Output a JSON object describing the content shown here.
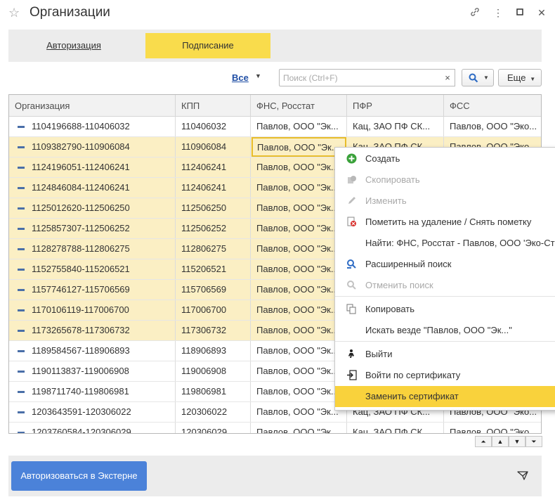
{
  "window": {
    "title": "Организации"
  },
  "tabs": [
    {
      "label": "Авторизация"
    },
    {
      "label": "Подписание"
    }
  ],
  "toolbar": {
    "filter_label": "Все",
    "search_placeholder": "Поиск (Ctrl+F)",
    "more_label": "Еще"
  },
  "table": {
    "columns": [
      "Организация",
      "КПП",
      "ФНС, Росстат",
      "ПФР",
      "ФСС"
    ],
    "rows": [
      {
        "org": "1104196688-110406032",
        "kpp": "110406032",
        "fns": "Павлов, ООО \"Эк...",
        "pfr": "Кац, ЗАО ПФ СК...",
        "fss": "Павлов, ООО \"Эко...",
        "selected": false
      },
      {
        "org": "1109382790-110906084",
        "kpp": "110906084",
        "fns": "Павлов, ООО \"Эк...",
        "pfr": "Кац, ЗАО ПФ СК...",
        "fss": "Павлов, ООО \"Эко...",
        "selected": true
      },
      {
        "org": "1124196051-112406241",
        "kpp": "112406241",
        "fns": "Павлов, ООО \"Эк...",
        "pfr": "",
        "fss": "",
        "selected": true
      },
      {
        "org": "1124846084-112406241",
        "kpp": "112406241",
        "fns": "Павлов, ООО \"Эк...",
        "pfr": "",
        "fss": "",
        "selected": true
      },
      {
        "org": "1125012620-112506250",
        "kpp": "112506250",
        "fns": "Павлов, ООО \"Эк...",
        "pfr": "",
        "fss": "",
        "selected": true
      },
      {
        "org": "1125857307-112506252",
        "kpp": "112506252",
        "fns": "Павлов, ООО \"Эк...",
        "pfr": "",
        "fss": "",
        "selected": true
      },
      {
        "org": "1128278788-112806275",
        "kpp": "112806275",
        "fns": "Павлов, ООО \"Эк...",
        "pfr": "",
        "fss": "",
        "selected": true
      },
      {
        "org": "1152755840-115206521",
        "kpp": "115206521",
        "fns": "Павлов, ООО \"Эк...",
        "pfr": "",
        "fss": "",
        "selected": true
      },
      {
        "org": "1157746127-115706569",
        "kpp": "115706569",
        "fns": "Павлов, ООО \"Эк...",
        "pfr": "",
        "fss": "",
        "selected": true
      },
      {
        "org": "1170106119-117006700",
        "kpp": "117006700",
        "fns": "Павлов, ООО \"Эк...",
        "pfr": "",
        "fss": "",
        "selected": true
      },
      {
        "org": "1173265678-117306732",
        "kpp": "117306732",
        "fns": "Павлов, ООО \"Эк...",
        "pfr": "",
        "fss": "",
        "selected": true
      },
      {
        "org": "1189584567-118906893",
        "kpp": "118906893",
        "fns": "Павлов, ООО \"Эк...",
        "pfr": "",
        "fss": "",
        "selected": false
      },
      {
        "org": "1190113837-119006908",
        "kpp": "119006908",
        "fns": "Павлов, ООО \"Эк...",
        "pfr": "",
        "fss": "",
        "selected": false
      },
      {
        "org": "1198711740-119806981",
        "kpp": "119806981",
        "fns": "Павлов, ООО \"Эк...",
        "pfr": "",
        "fss": "",
        "selected": false
      },
      {
        "org": "1203643591-120306022",
        "kpp": "120306022",
        "fns": "Павлов, ООО \"Эк...",
        "pfr": "Кац, ЗАО ПФ СК...",
        "fss": "Павлов, ООО \"Эко...",
        "selected": false
      },
      {
        "org": "1203760584-120306029",
        "kpp": "120306029",
        "fns": "Павлов, ООО \"Эк...",
        "pfr": "Кац, ЗАО ПФ СК...",
        "fss": "Павлов, ООО \"Эко...",
        "selected": false
      }
    ]
  },
  "context_menu": {
    "items": [
      {
        "label": "Создать",
        "icon": "plus-circle-icon",
        "disabled": false
      },
      {
        "label": "Скопировать",
        "icon": "copy-icon",
        "disabled": true
      },
      {
        "label": "Изменить",
        "icon": "pencil-icon",
        "disabled": true
      },
      {
        "label": "Пометить на удаление / Снять пометку",
        "icon": "delete-mark-icon",
        "disabled": false
      },
      {
        "label": "Найти: ФНС, Росстат - Павлов, ООО 'Эко-Стр",
        "icon": "",
        "disabled": false
      },
      {
        "label": "Расширенный поиск",
        "icon": "advanced-search-icon",
        "disabled": false
      },
      {
        "label": "Отменить поиск",
        "icon": "cancel-search-icon",
        "disabled": true
      },
      {
        "label": "Копировать",
        "icon": "copy-clipboard-icon",
        "disabled": false
      },
      {
        "label": "Искать везде \"Павлов, ООО \"Эк...\"",
        "icon": "",
        "disabled": false
      },
      {
        "label": "Выйти",
        "icon": "logout-icon",
        "disabled": false
      },
      {
        "label": "Войти по сертификату",
        "icon": "login-icon",
        "disabled": false
      },
      {
        "label": "Заменить сертификат",
        "icon": "",
        "disabled": false,
        "highlighted": true
      }
    ]
  },
  "footer": {
    "primary_button": "Авторизоваться в Экстерне"
  },
  "colors": {
    "accent": "#f9dc4c",
    "selection": "#fbefc4",
    "primary": "#4b82d9",
    "link": "#1f4ea5"
  }
}
